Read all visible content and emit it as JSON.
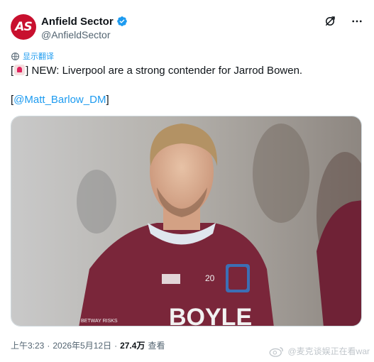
{
  "author": {
    "display_name": "Anfield Sector",
    "handle": "@AnfieldSector",
    "avatar_text": "AS",
    "verified": true
  },
  "actions": {
    "grok_icon": "grok-icon",
    "more_icon": "more-icon"
  },
  "translate": {
    "label": "显示翻译"
  },
  "tweet": {
    "prefix_open": "[",
    "prefix_close": "] NEW: Liverpool are a strong contender for Jarrod Bowen.",
    "mention_open": "[",
    "mention": "@Matt_Barlow_DM",
    "mention_close": "]"
  },
  "media": {
    "shirt_sponsor": "BOYLE",
    "shirt_number": "20",
    "sleeve_text": "BETWAY RISKS"
  },
  "meta": {
    "time": "上午3:23",
    "date": "2026年5月12日",
    "views_count": "27.4万",
    "views_label": "查看"
  },
  "watermark": {
    "text": "@麦克谈娱正在看war"
  },
  "colors": {
    "accent": "#1d9bf0",
    "avatar_bg": "#c8102e",
    "shirt": "#7a263a"
  }
}
